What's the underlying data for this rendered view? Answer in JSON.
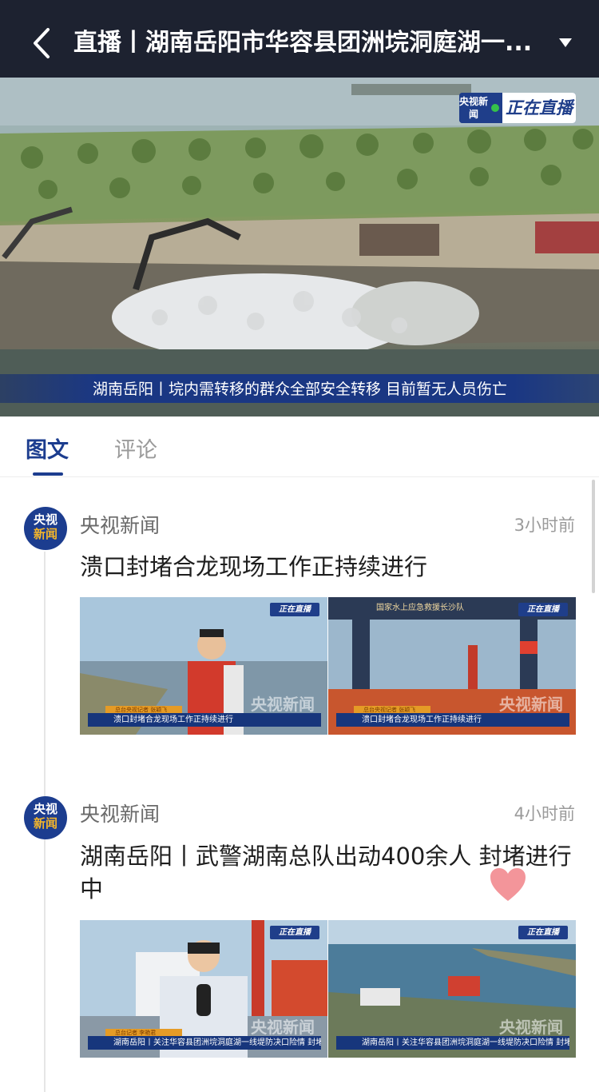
{
  "header": {
    "back_icon": "chevron-left-icon",
    "title": "直播丨湖南岳阳市华容县团洲垸洞庭湖一...",
    "dropdown_icon": "triangle-down-icon",
    "background": "#1d2230"
  },
  "video": {
    "logo_cctv": "央视新闻",
    "logo_live": "正在直播",
    "caption": "湖南岳阳丨垸内需转移的群众全部安全转移 目前暂无人员伤亡"
  },
  "tabs": [
    {
      "label": "图文",
      "active": true
    },
    {
      "label": "评论",
      "active": false
    }
  ],
  "accent_color": "#1c3d8f",
  "posts": [
    {
      "avatar_line1": "央视",
      "avatar_line2": "新闻",
      "source": "央视新闻",
      "time": "3小时前",
      "headline": "溃口封堵合龙现场工作正持续进行",
      "images": [
        {
          "logo": "正在直播",
          "watermark": "央视新闻",
          "lower_tag": "总台央视记者 张颖飞",
          "lower_third": "溃口封堵合龙现场工作正持续进行"
        },
        {
          "logo": "正在直播",
          "watermark": "央视新闻",
          "banner": "国家水上应急救援长沙队",
          "lower_tag": "总台央视记者 张颖飞",
          "lower_third": "溃口封堵合龙现场工作正持续进行"
        }
      ]
    },
    {
      "avatar_line1": "央视",
      "avatar_line2": "新闻",
      "source": "央视新闻",
      "time": "4小时前",
      "headline": "湖南岳阳丨武警湖南总队出动400余人 封堵进行中",
      "images": [
        {
          "logo": "正在直播",
          "watermark": "央视新闻",
          "lower_tag": "总台记者 李艳君",
          "lower_third": "湖南岳阳丨关注华容县团洲垸洞庭湖一线堤防决口险情 封堵进行中"
        },
        {
          "logo": "正在直播",
          "watermark": "央视新闻",
          "lower_third": "湖南岳阳丨关注华容县团洲垸洞庭湖一线堤防决口险情 封堵进行中"
        }
      ]
    }
  ],
  "floating_icon": "heart-icon"
}
